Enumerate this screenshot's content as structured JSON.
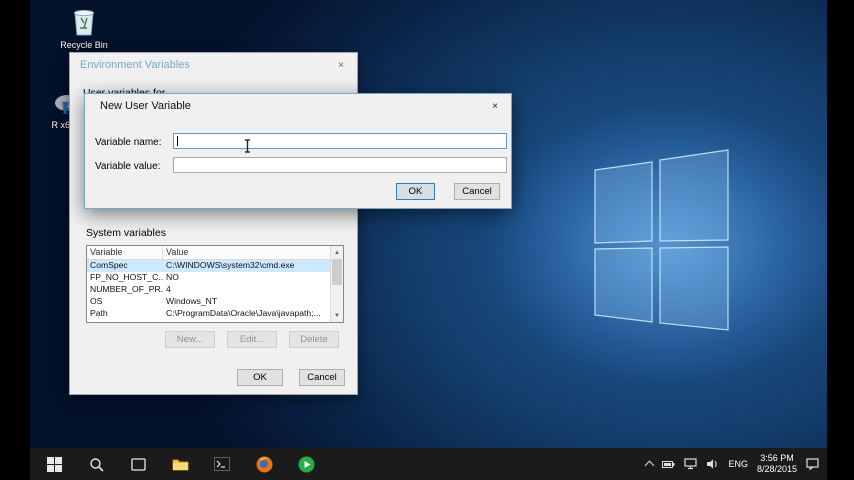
{
  "desktop": {
    "icons": [
      {
        "label": "Recycle Bin"
      },
      {
        "label": "R x64..."
      }
    ]
  },
  "env_dialog": {
    "title": "Environment Variables",
    "close_label": "×",
    "user_section_label": "User variables for",
    "system_section_label": "System variables",
    "table": {
      "columns": [
        "Variable",
        "Value"
      ],
      "scroll_up": "▲",
      "scroll_down": "▼",
      "rows": [
        {
          "variable": "ComSpec",
          "value": "C:\\WINDOWS\\system32\\cmd.exe"
        },
        {
          "variable": "FP_NO_HOST_C...",
          "value": "NO"
        },
        {
          "variable": "NUMBER_OF_PR...",
          "value": "4"
        },
        {
          "variable": "OS",
          "value": "Windows_NT"
        },
        {
          "variable": "Path",
          "value": "C:\\ProgramData\\Oracle\\Java\\javapath;..."
        }
      ]
    },
    "buttons": {
      "new_label": "New...",
      "edit_label": "Edit...",
      "delete_label": "Delete",
      "ok_label": "OK",
      "cancel_label": "Cancel"
    }
  },
  "new_var_dialog": {
    "title": "New User Variable",
    "close_label": "×",
    "fields": [
      {
        "label": "Variable name:",
        "value": ""
      },
      {
        "label": "Variable value:",
        "value": ""
      }
    ],
    "ok_label": "OK",
    "cancel_label": "Cancel"
  },
  "taskbar": {
    "tray": {
      "language": "ENG",
      "time": "3:56 PM",
      "date": "8/28/2015"
    }
  },
  "colors": {
    "accent": "#0078d7",
    "selection": "#cde8ff",
    "taskbar": "#1b1b1b"
  }
}
